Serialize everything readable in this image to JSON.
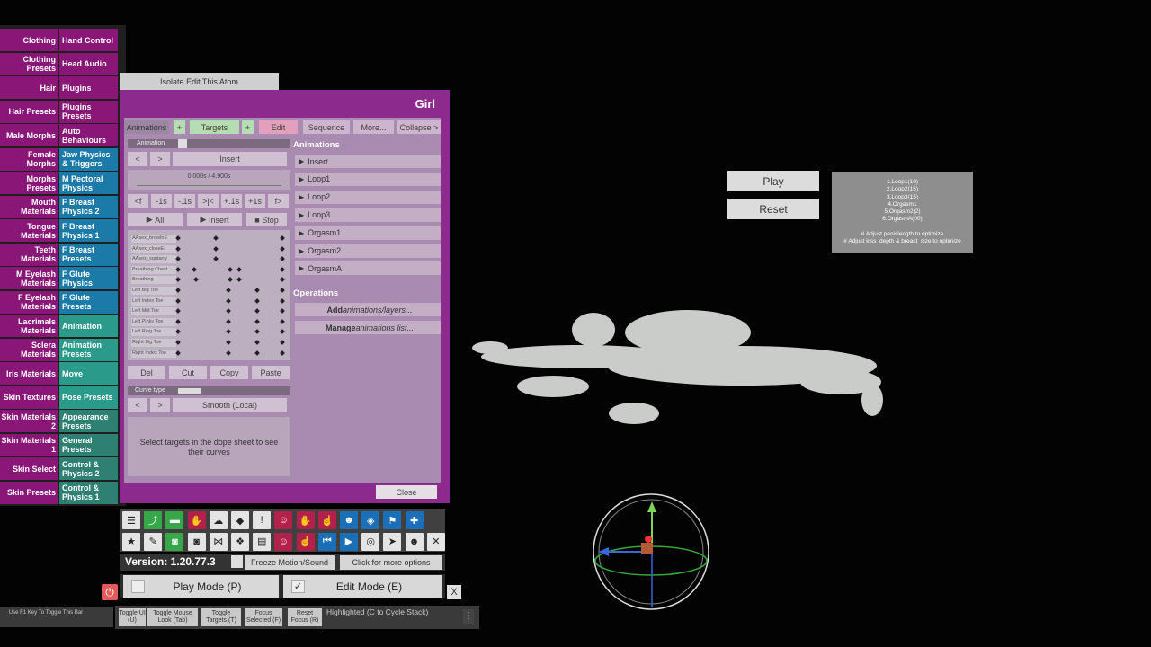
{
  "left_menu": [
    {
      "left": "Clothing",
      "right": "Hand Control",
      "right_color": "#8a1677"
    },
    {
      "left": "Clothing Presets",
      "right": "Head Audio",
      "right_color": "#8a1677"
    },
    {
      "left": "Hair",
      "right": "Plugins",
      "right_color": "#8a1677"
    },
    {
      "left": "Hair Presets",
      "right": "Plugins Presets",
      "right_color": "#8a1677"
    },
    {
      "left": "Male Morphs",
      "right": "Auto Behaviours",
      "right_color": "#8a1677"
    },
    {
      "left": "Female Morphs",
      "right": "Jaw Physics & Triggers",
      "right_color": "#1b7aa8"
    },
    {
      "left": "Morphs Presets",
      "right": "M Pectoral Physics",
      "right_color": "#1b7aa8"
    },
    {
      "left": "Mouth Materials",
      "right": "F Breast Physics 2",
      "right_color": "#1b7aa8"
    },
    {
      "left": "Tongue Materials",
      "right": "F Breast Physics 1",
      "right_color": "#1b7aa8"
    },
    {
      "left": "Teeth Materials",
      "right": "F Breast Presets",
      "right_color": "#1b7aa8"
    },
    {
      "left": "M Eyelash Materials",
      "right": "F Glute Physics",
      "right_color": "#1b7aa8"
    },
    {
      "left": "F Eyelash Materials",
      "right": "F Glute Presets",
      "right_color": "#1b7aa8"
    },
    {
      "left": "Lacrimals Materials",
      "right": "Animation",
      "right_color": "#2a9a8a"
    },
    {
      "left": "Sclera Materials",
      "right": "Animation Presets",
      "right_color": "#2a9a8a"
    },
    {
      "left": "Iris Materials",
      "right": "Move",
      "right_color": "#2a9a8a"
    },
    {
      "left": "Skin Textures",
      "right": "Pose Presets",
      "right_color": "#2a9a8a"
    },
    {
      "left": "Skin Materials 2",
      "right": "Appearance Presets",
      "right_color": "#2e8072"
    },
    {
      "left": "Skin Materials 1",
      "right": "General Presets",
      "right_color": "#2e8072"
    },
    {
      "left": "Skin Select",
      "right": "Control & Physics 2",
      "right_color": "#2e8072"
    },
    {
      "left": "Skin Presets",
      "right": "Control & Physics 1",
      "right_color": "#2e8072"
    }
  ],
  "isolate_label": "Isolate Edit This Atom",
  "panel": {
    "title": "Girl",
    "tabs": [
      "Animations",
      "+",
      "Targets",
      "+",
      "Edit",
      "Sequence",
      "More...",
      "Collapse >"
    ],
    "animation_label": "Animation",
    "nav_prev": "<",
    "nav_next": ">",
    "insert_label": "Insert",
    "time_display": "0.000s / 4.900s",
    "step_buttons": [
      "<f",
      "-1s",
      "-.1s",
      ">|<",
      "+.1s",
      "+1s",
      "f>"
    ],
    "play_all": "All",
    "play_insert": "Insert",
    "stop": "Stop",
    "dope_labels": [
      "AAsex_browInE",
      "AAsex_closeEt",
      "AAsex_sqntarry",
      "Breathing Chest",
      "Breathing",
      "Left Big Toe",
      "Left Index Toe",
      "Left Mid Toe",
      "Left Pinky Toe",
      "Left Ring Toe",
      "Right Big Toe",
      "Right Index Toe"
    ],
    "edit_buttons": [
      "Del",
      "Cut",
      "Copy",
      "Paste"
    ],
    "curve_type_label": "Curve type",
    "curve_value": "Smooth (Local)",
    "hint": "Select targets in the dope sheet to see their curves",
    "animations_heading": "Animations",
    "animations": [
      "Insert",
      "Loop1",
      "Loop2",
      "Loop3",
      "Orgasm1",
      "Orgasm2",
      "OrgasmA"
    ],
    "operations_heading": "Operations",
    "op_add": {
      "verb": "Add",
      "rest": " animations/layers..."
    },
    "op_manage": {
      "verb": "Manage",
      "rest": " animations list..."
    },
    "close": "Close"
  },
  "toolbar": {
    "row1": [
      "menu-icon",
      "scene-open-icon",
      "folder-icon",
      "hand-red-icon",
      "cloud-icon",
      "cube-icon",
      "warning-icon",
      "person-icon",
      "hand-icon",
      "pointer-hand-icon",
      "person-select-icon",
      "unity-icon",
      "flag-icon",
      "plus-icon"
    ],
    "row2": [
      "star-icon",
      "edit-icon",
      "camera-green-icon",
      "camera-icon",
      "nodes-icon",
      "dropbox-icon",
      "document-icon",
      "person-icon",
      "hand-cursor-icon",
      "skip-back-icon",
      "play-icon",
      "target-icon",
      "cursor-icon",
      "people-icon",
      "tools-icon"
    ]
  },
  "version": "Version: 1.20.77.3",
  "freeze_label": "Freeze Motion/Sound",
  "more_options": "Click for more options",
  "play_mode": "Play Mode (P)",
  "edit_mode": "Edit Mode (E)",
  "close_x": "X",
  "f1_hint": "Use F1 Key To Toggle This Bar",
  "bottom_buttons": [
    "Toggle UI (U)",
    "Toggle Mouse Look (Tab)",
    "Toggle Targets (T)",
    "Focus Selected (F)",
    "Reset Focus (R)"
  ],
  "highlighted": "Highlighted (C to Cycle Stack)",
  "scene": {
    "play": "Play",
    "reset": "Reset",
    "info_lines": [
      "1.Loop1(10)",
      "2.Loop2(15)",
      "3.Loop3(15)",
      "4.Orgasm1",
      "5.Orgasm2(2)",
      "6.OrgasmA(00)",
      "",
      "# Adjust penislength to optimize",
      "# Adjust kiss_depth & breast_size to optimize"
    ]
  }
}
